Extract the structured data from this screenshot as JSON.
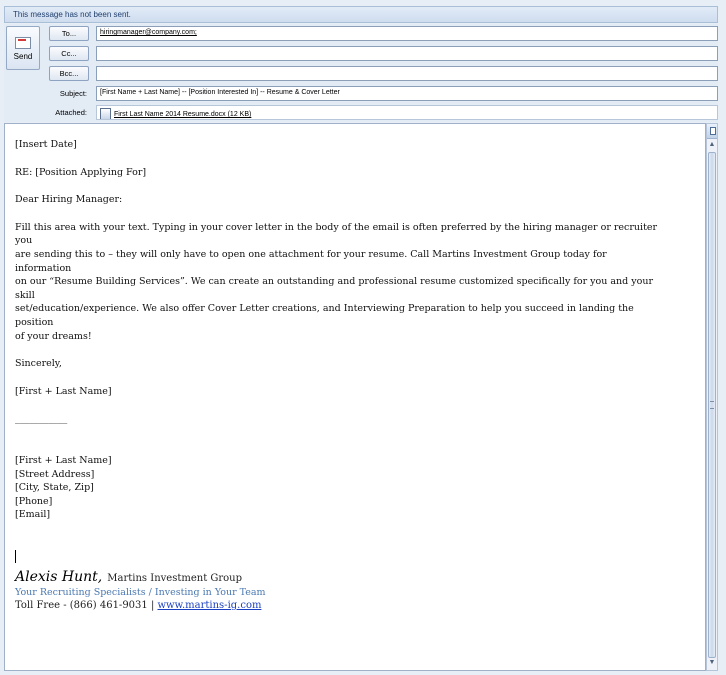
{
  "notice": "This message has not been sent.",
  "header": {
    "send_label": "Send",
    "to_button": "To...",
    "cc_button": "Cc...",
    "bcc_button": "Bcc...",
    "to_value": "hiringmanager@company.com;",
    "cc_value": "",
    "bcc_value": "",
    "subject_label": "Subject:",
    "subject_value": "[First Name + Last Name] -- [Position Interested In] -- Resume & Cover Letter",
    "attached_label": "Attached:",
    "attachment": "First Last Name 2014 Resume.docx (12 KB)"
  },
  "body": {
    "date": "[Insert Date]",
    "re": "RE: [Position Applying For]",
    "greeting": "Dear Hiring Manager:",
    "paragraph_lines": [
      "Fill this area with your text. Typing in your cover letter in the body of the email is often preferred by the hiring manager or recruiter you",
      "are sending this to – they will only have to open one attachment for your resume. Call Martins Investment Group today for information",
      "on our “Resume Building Services”. We can create an outstanding and professional resume customized specifically for you and your skill",
      "set/education/experience. We also offer Cover Letter creations, and Interviewing Preparation to help you succeed in landing the position",
      "of your dreams!"
    ],
    "closing": "Sincerely,",
    "name_line": "[First + Last Name]",
    "signature_rule": "___________",
    "contact": {
      "name": "[First + Last Name]",
      "street": "[Street Address]",
      "city": "[City, State, Zip]",
      "phone": "[Phone]",
      "email": "[Email]"
    }
  },
  "signature": {
    "name": "Alexis Hunt,",
    "company": "Martins Investment Group",
    "tagline": "Your Recruiting Specialists / Investing in Your Team",
    "phone": "Toll Free - (866) 461-9031 |",
    "website": "www.martins-ig.com"
  },
  "colors": {
    "tagline": "#4a78b0",
    "link": "#1b3fc0",
    "chrome": "#e3ebf5"
  }
}
